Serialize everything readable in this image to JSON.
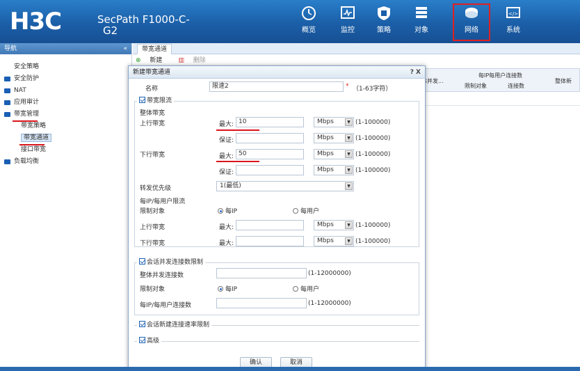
{
  "header": {
    "logo": "H3C",
    "product_line1": "SecPath F1000-C-",
    "product_line2": "G2",
    "nav": [
      {
        "label": "概览",
        "icon": "dashboard-icon"
      },
      {
        "label": "监控",
        "icon": "monitor-icon"
      },
      {
        "label": "策略",
        "icon": "shield-icon"
      },
      {
        "label": "对象",
        "icon": "objects-icon"
      },
      {
        "label": "网络",
        "icon": "network-icon",
        "active": true
      },
      {
        "label": "系统",
        "icon": "system-icon"
      }
    ]
  },
  "sidebar": {
    "title": "导航",
    "collapse": "«",
    "items": [
      {
        "label": "安全策略"
      },
      {
        "label": "安全防护"
      },
      {
        "label": "NAT"
      },
      {
        "label": "应用审计"
      },
      {
        "label": "带宽管理"
      },
      {
        "label": "带宽策略"
      },
      {
        "label": "带宽通道"
      },
      {
        "label": "接口带宽"
      },
      {
        "label": "负载均衡"
      }
    ]
  },
  "main": {
    "tab": "带宽通道",
    "toolbar": {
      "new": "新建",
      "delete": "删除"
    },
    "table_headers": {
      "concurrent": "体并发...",
      "per_ip_conn": "每IP每用户连接数",
      "limit_obj": "限制对象",
      "conn_count": "连接数",
      "overall_new": "整体新"
    }
  },
  "dialog": {
    "title": "新建带宽通道",
    "title_buttons": "? X",
    "name_label": "名称",
    "name_value": "限速2",
    "name_required": "*",
    "name_hint": "（1-63字符）",
    "bandwidth_section": "带宽限流",
    "overall_bw": "整体带宽",
    "up_bw": "上行带宽",
    "down_bw": "下行带宽",
    "max_label": "最大:",
    "guar_label": "保证:",
    "up_max_value": "10",
    "down_max_value": "50",
    "unit": "Mbps",
    "range_bw": "(1-100000)",
    "priority_label": "转发优先级",
    "priority_value": "1(最低)",
    "per_ip_section": "每IP/每用户限流",
    "limit_obj_label": "限制对象",
    "per_ip": "每IP",
    "per_user": "每用户",
    "session_section": "会话并发连接数限制",
    "overall_concurrent": "整体并发连接数",
    "per_ip_conn_label": "每IP/每用户连接数",
    "range_conn": "(1-12000000)",
    "new_conn_section": "会话新建连接速率限制",
    "advanced_section": "高级",
    "ok": "确认",
    "cancel": "取消"
  },
  "colors": {
    "header_blue": "#1b5fa8",
    "highlight_red": "#d9151b"
  }
}
